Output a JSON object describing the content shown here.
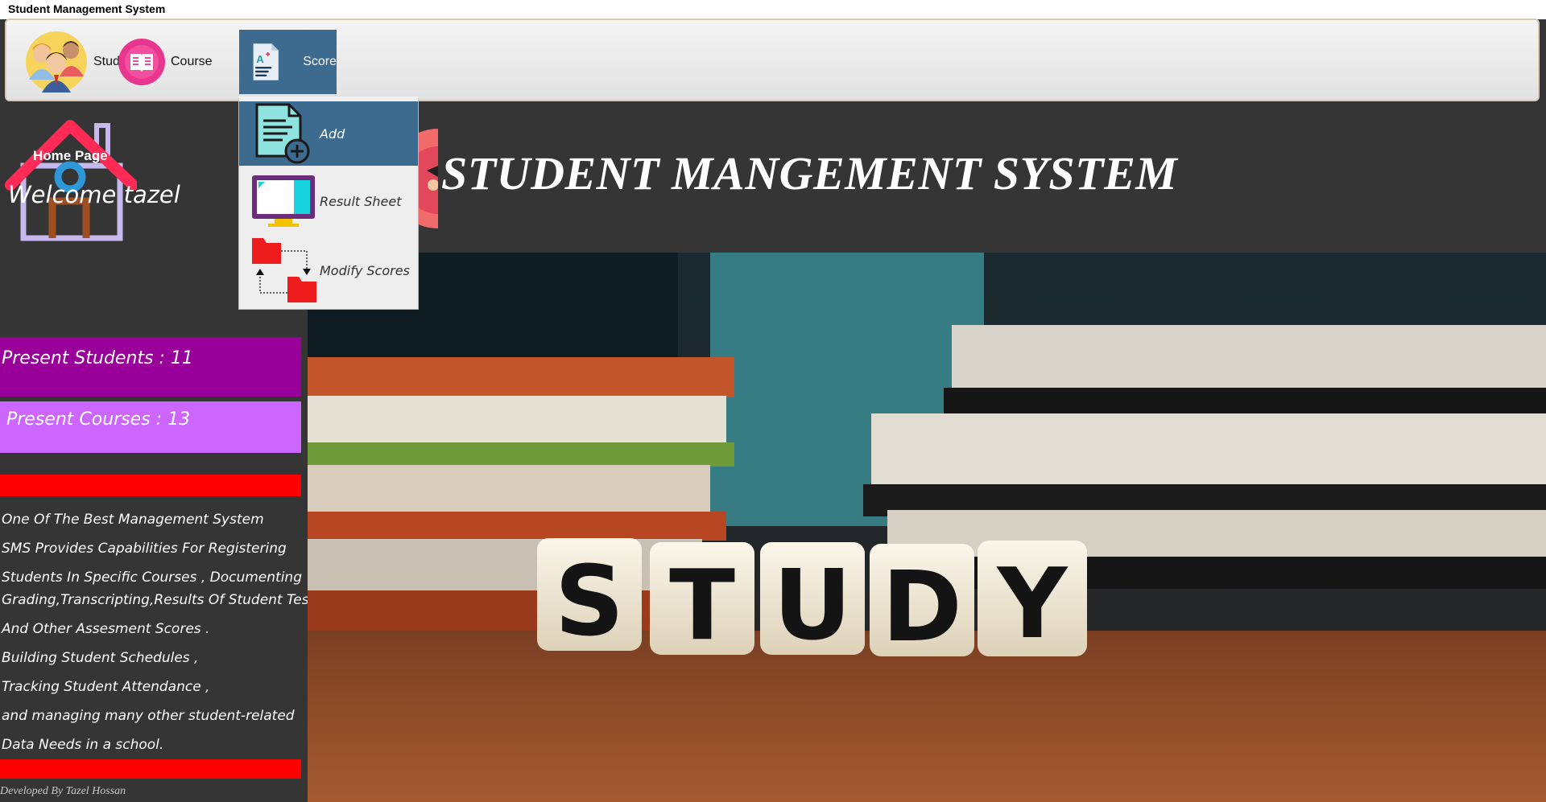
{
  "window": {
    "title": "Student Management System"
  },
  "menubar": {
    "student_label": "Student",
    "course_label": "Course",
    "score_label": "Score"
  },
  "score_menu": {
    "items": [
      {
        "label": "Add"
      },
      {
        "label": "Result Sheet"
      },
      {
        "label": "Modify Scores"
      }
    ]
  },
  "sidebar": {
    "home_label": "Home Page",
    "welcome": "Welcome tazel",
    "present_students": "Present Students : 11",
    "present_courses": "Present Courses : 13",
    "description": [
      "One Of The Best Management System",
      "SMS Provides Capabilities For Registering",
      "Students In Specific Courses  , Documenting",
      "Grading,Transcripting,Results Of Student Tests",
      "And Other Assesment Scores .",
      " Building Student Schedules ,",
      "Tracking Student Attendance ,",
      " and managing many other student-related",
      " Data Needs in a school."
    ],
    "footer": "Developed By Tazel Hossan"
  },
  "main": {
    "title": "STUDENT MANGEMENT SYSTEM",
    "image_text": "STUDY"
  },
  "colors": {
    "background": "#353535",
    "menu_highlight": "#3d6a8f",
    "students_panel": "#990099",
    "courses_panel": "#cc66ff",
    "divider": "#ff0000"
  }
}
